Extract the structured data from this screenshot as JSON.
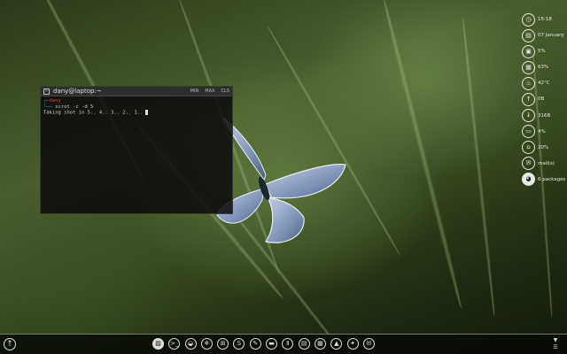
{
  "terminal": {
    "title": "dany@laptop:~",
    "controls": [
      "MIN",
      "MAX",
      "CLS"
    ],
    "prompt_user": "dany",
    "prompt_corner": "┌─",
    "command_prefix": "└──",
    "command": "scrot -c -d 5",
    "output": "Taking shot in 5.. 4.. 3.. 2.. 1.."
  },
  "widgets": [
    {
      "icon": "clock-icon",
      "glyph": "◷",
      "text": "15:18"
    },
    {
      "icon": "calendar-icon",
      "glyph": "▤",
      "text": "07 January"
    },
    {
      "icon": "cpu-icon",
      "glyph": "▣",
      "text": "5%"
    },
    {
      "icon": "memory-icon",
      "glyph": "▦",
      "text": "63%"
    },
    {
      "icon": "temperature-icon",
      "glyph": "♨",
      "text": "42°C"
    },
    {
      "icon": "upload-icon",
      "glyph": "↑",
      "text": "0B"
    },
    {
      "icon": "download-icon",
      "glyph": "↓",
      "text": "316B"
    },
    {
      "icon": "disk-root-icon",
      "glyph": "▭",
      "text": "4%"
    },
    {
      "icon": "disk-home-icon",
      "glyph": "⌂",
      "text": "20%"
    },
    {
      "icon": "mail-icon",
      "glyph": "✉",
      "text": "mail(s)"
    },
    {
      "icon": "packages-icon",
      "glyph": "◕",
      "text": "6 packages"
    }
  ],
  "taskbar": {
    "menu_glyph": "↑",
    "launchers": [
      {
        "name": "files-launcher",
        "glyph": "▧",
        "active": true
      },
      {
        "name": "terminal-launcher",
        "glyph": ">_",
        "active": false
      },
      {
        "name": "gimp-launcher",
        "glyph": "◒",
        "active": false
      },
      {
        "name": "browser-launcher",
        "glyph": "❄",
        "active": false
      },
      {
        "name": "apps-launcher",
        "glyph": "⊞",
        "active": false
      },
      {
        "name": "skype-launcher",
        "glyph": "S",
        "active": false
      },
      {
        "name": "editor-launcher",
        "glyph": "✎",
        "active": false
      },
      {
        "name": "media-launcher",
        "glyph": "▬",
        "active": false
      },
      {
        "name": "mixer-launcher",
        "glyph": "Ⅱ",
        "active": false
      },
      {
        "name": "chat-launcher",
        "glyph": "▤",
        "active": false
      },
      {
        "name": "calculator-launcher",
        "glyph": "▦",
        "active": false
      },
      {
        "name": "vlc-launcher",
        "glyph": "▲",
        "active": false
      },
      {
        "name": "settings-launcher",
        "glyph": "✦",
        "active": false
      },
      {
        "name": "mail-launcher",
        "glyph": "✉",
        "active": false
      }
    ],
    "tray_glyph": "▼"
  },
  "colors": {
    "prompt_user": "#d04040",
    "prompt_corner": "#5080c0",
    "widget_fg": "#e8e8e8"
  }
}
